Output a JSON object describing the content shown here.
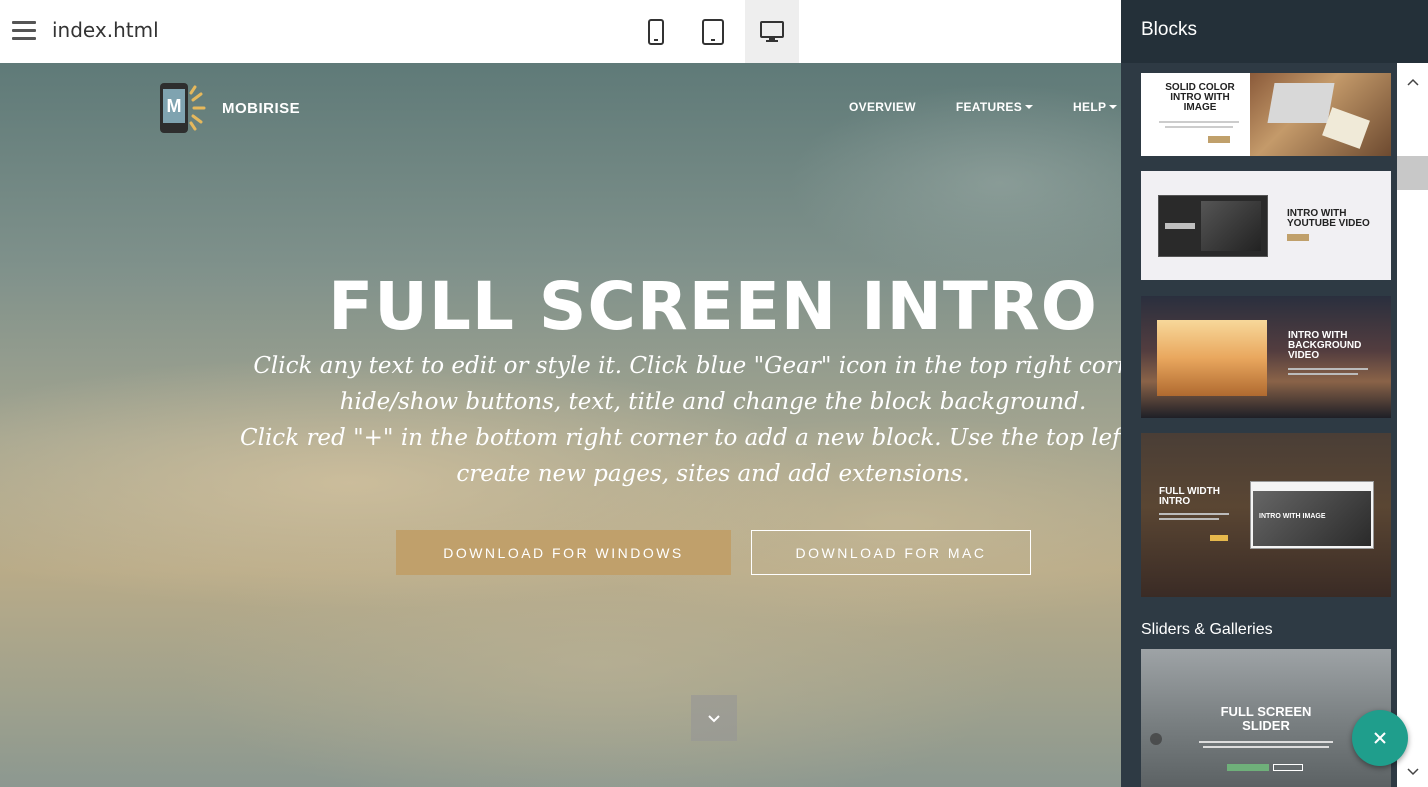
{
  "topbar": {
    "file_name": "index.html",
    "devices": [
      {
        "name": "phone-icon",
        "active": false
      },
      {
        "name": "tablet-icon",
        "active": false
      },
      {
        "name": "desktop-icon",
        "active": true
      }
    ]
  },
  "hero": {
    "brand": "MOBIRISE",
    "logo_letter": "M",
    "nav": [
      "OVERVIEW",
      "FEATURES",
      "HELP"
    ],
    "title": "FULL SCREEN INTRO",
    "text_lines": [
      "Click any text to edit or style it. Click blue \"Gear\" icon in the top right corner t",
      "hide/show buttons, text, title and change the block background.",
      "Click red \"+\" in the bottom right corner to add a new block. Use the top left menu",
      "create new pages, sites and add extensions."
    ],
    "button_windows": "DOWNLOAD FOR WINDOWS",
    "button_mac": "DOWNLOAD FOR MAC",
    "accent": "#c0a06b"
  },
  "panel": {
    "title": "Blocks",
    "thumbs": [
      {
        "label": "SOLID COLOR INTRO WITH IMAGE"
      },
      {
        "label": "INTRO WITH YOUTUBE VIDEO"
      },
      {
        "label": "INTRO WITH BACKGROUND VIDEO"
      },
      {
        "label": "FULL WIDTH INTRO",
        "inner_label": "INTRO WITH IMAGE"
      },
      {
        "label": "FULL SCREEN SLIDER"
      }
    ],
    "section": "Sliders & Galleries",
    "fab_icon": "close-icon",
    "fab_color": "#1f9e8c"
  }
}
